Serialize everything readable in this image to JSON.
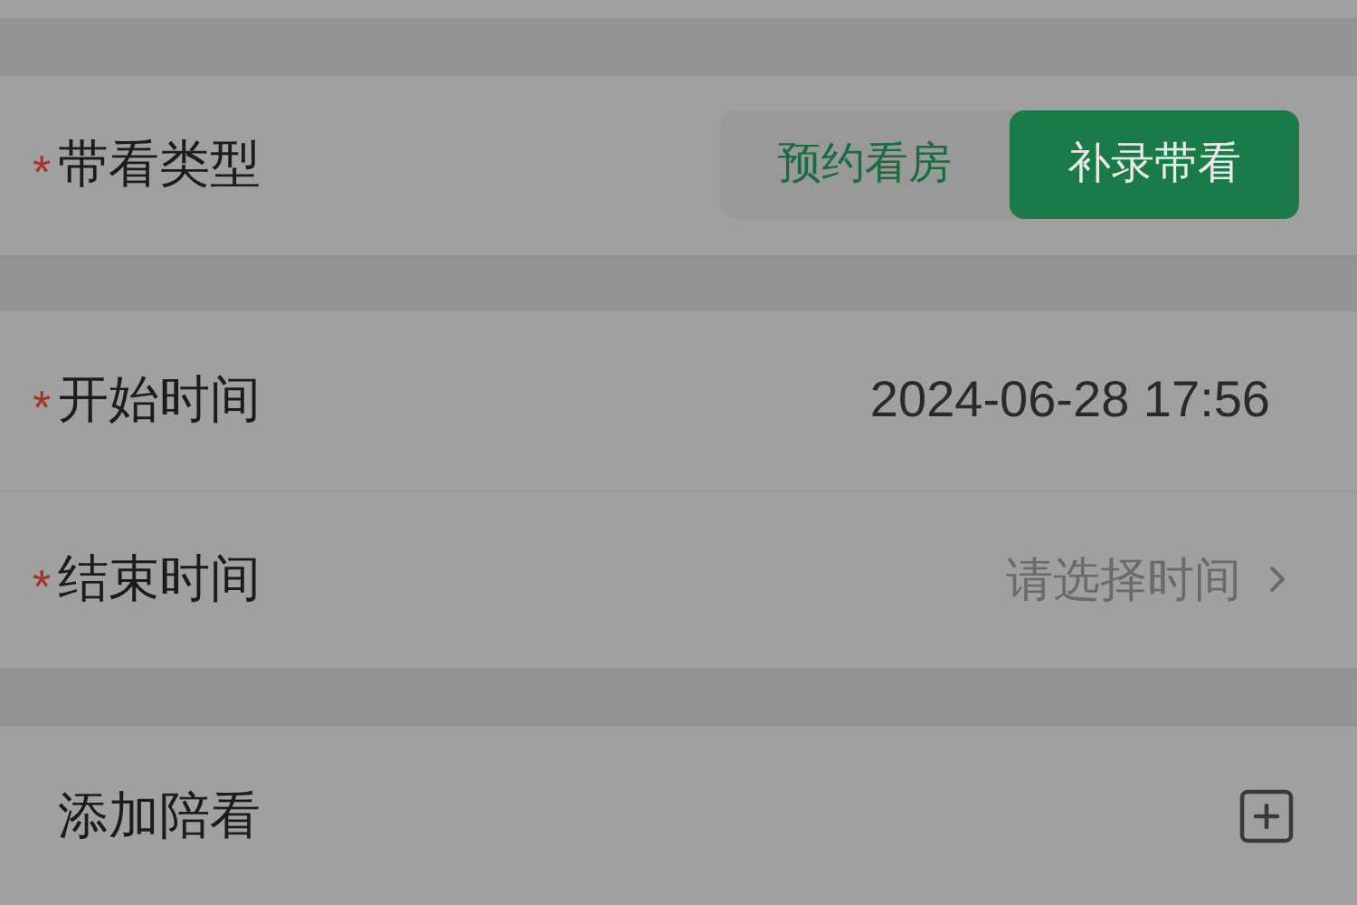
{
  "fields": [
    {
      "kind": "segmented",
      "required_mark": "*",
      "label": "带看类型",
      "options": [
        {
          "label": "预约看房",
          "selected": false
        },
        {
          "label": "补录带看",
          "selected": true
        }
      ]
    },
    {
      "kind": "value",
      "required_mark": "*",
      "label": "开始时间",
      "value": "2024-06-28 17:56"
    },
    {
      "kind": "picker",
      "required_mark": "*",
      "label": "结束时间",
      "placeholder": "请选择时间"
    },
    {
      "kind": "add",
      "label": "添加陪看"
    }
  ]
}
